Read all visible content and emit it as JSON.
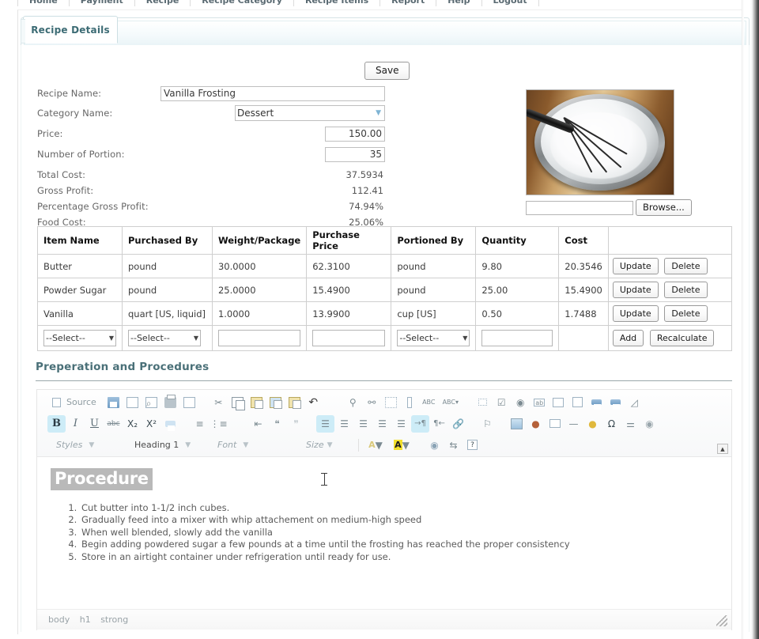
{
  "topnav": {
    "items": [
      "Home",
      "Payment",
      "Recipe",
      "Recipe Category",
      "Recipe Items",
      "Report",
      "Help",
      "Logout"
    ]
  },
  "tab": {
    "label": "Recipe Details"
  },
  "toolbar": {
    "save_label": "Save"
  },
  "form": {
    "recipe_name": {
      "label": "Recipe Name:",
      "value": "Vanilla Frosting"
    },
    "category_name": {
      "label": "Category Name:",
      "value": "Dessert"
    },
    "price": {
      "label": "Price:",
      "value": "150.00"
    },
    "portions": {
      "label": "Number of Portion:",
      "value": "35"
    },
    "total_cost": {
      "label": "Total Cost:",
      "value": "37.5934"
    },
    "gross_profit": {
      "label": "Gross Profit:",
      "value": "112.41"
    },
    "pct_gross_profit": {
      "label": "Percentage Gross Profit:",
      "value": "74.94%"
    },
    "food_cost": {
      "label": "Food Cost:",
      "value": "25.06%"
    }
  },
  "image": {
    "alt": "whisk-in-bowl-of-white-frosting",
    "file_value": "",
    "browse_label": "Browse..."
  },
  "items_table": {
    "columns": [
      "Item Name",
      "Purchased By",
      "Weight/Package",
      "Purchase Price",
      "Portioned By",
      "Quantity",
      "Cost",
      ""
    ],
    "rows": [
      {
        "item_name": "Butter",
        "purchased_by": "pound",
        "weight_package": "30.0000",
        "purchase_price": "62.3100",
        "portioned_by": "pound",
        "quantity": "9.80",
        "cost": "20.3546",
        "update_label": "Update",
        "delete_label": "Delete"
      },
      {
        "item_name": "Powder Sugar",
        "purchased_by": "pound",
        "weight_package": "25.0000",
        "purchase_price": "15.4900",
        "portioned_by": "pound",
        "quantity": "25.00",
        "cost": "15.4900",
        "update_label": "Update",
        "delete_label": "Delete"
      },
      {
        "item_name": "Vanilla",
        "purchased_by": "quart [US, liquid]",
        "weight_package": "1.0000",
        "purchase_price": "13.9900",
        "portioned_by": "cup [US]",
        "quantity": "0.50",
        "cost": "1.7488",
        "update_label": "Update",
        "delete_label": "Delete"
      }
    ],
    "new_row": {
      "item_select": "--Select--",
      "purchased_by_select": "--Select--",
      "weight_package": "",
      "purchase_price": "",
      "portioned_by_select": "--Select--",
      "quantity": "",
      "cost": "",
      "add_label": "Add",
      "recalculate_label": "Recalculate"
    }
  },
  "section": {
    "title": "Preperation and Procedures"
  },
  "editor": {
    "toolbar_row1": [
      {
        "name": "source-icon",
        "label": "Source"
      },
      {
        "name": "new-page-icon"
      },
      {
        "name": "save-icon"
      },
      {
        "name": "preview-icon"
      },
      {
        "name": "print-icon"
      },
      {
        "name": "templates-icon"
      },
      {
        "name": "cut-icon"
      },
      {
        "name": "copy-icon"
      },
      {
        "name": "paste-icon"
      },
      {
        "name": "paste-plain-text-icon"
      },
      {
        "name": "paste-from-word-icon"
      },
      {
        "name": "undo-icon"
      },
      {
        "name": "find-icon"
      },
      {
        "name": "replace-icon"
      },
      {
        "name": "select-all-icon"
      },
      {
        "name": "remove-format-icon"
      },
      {
        "name": "spell-check-icon"
      },
      {
        "name": "spell-check-as-you-type-icon"
      },
      {
        "name": "form-icon"
      },
      {
        "name": "checkbox-icon"
      },
      {
        "name": "radio-button-icon"
      },
      {
        "name": "text-field-icon"
      },
      {
        "name": "textarea-icon"
      },
      {
        "name": "selection-field-icon"
      },
      {
        "name": "button-icon"
      },
      {
        "name": "image-button-icon"
      },
      {
        "name": "hidden-field-icon"
      }
    ],
    "toolbar_row2": [
      {
        "name": "bold-icon",
        "label": "B",
        "active": true
      },
      {
        "name": "italic-icon",
        "label": "I"
      },
      {
        "name": "underline-icon",
        "label": "U"
      },
      {
        "name": "strikethrough-icon",
        "label": "abc"
      },
      {
        "name": "subscript-icon",
        "label": "X₂"
      },
      {
        "name": "superscript-icon",
        "label": "X²"
      },
      {
        "name": "remove-format-icon"
      },
      {
        "name": "numbered-list-icon"
      },
      {
        "name": "bulleted-list-icon"
      },
      {
        "name": "decrease-indent-icon"
      },
      {
        "name": "increase-indent-icon"
      },
      {
        "name": "blockquote-icon"
      },
      {
        "name": "create-div-icon"
      },
      {
        "name": "align-left-icon",
        "active": true
      },
      {
        "name": "align-center-icon"
      },
      {
        "name": "align-right-icon"
      },
      {
        "name": "justify-icon"
      },
      {
        "name": "text-direction-ltr-icon",
        "active": true
      },
      {
        "name": "text-direction-rtl-icon"
      },
      {
        "name": "link-icon"
      },
      {
        "name": "anchor-icon"
      },
      {
        "name": "image-icon"
      },
      {
        "name": "flash-icon"
      },
      {
        "name": "table-icon"
      },
      {
        "name": "horizontal-rule-icon"
      },
      {
        "name": "smiley-icon"
      },
      {
        "name": "special-character-icon"
      },
      {
        "name": "page-break-icon"
      },
      {
        "name": "iframe-icon"
      }
    ],
    "toolbar_row3": {
      "styles_label": "Styles",
      "format_label": "Heading 1",
      "font_label": "Font",
      "size_label": "Size",
      "text_color_label": "A",
      "bg_color_label": "A",
      "maximize_name": "maximize-icon",
      "show_blocks_name": "show-blocks-icon",
      "about_label": "?"
    },
    "collapse_label": "▲",
    "content": {
      "heading": "Procedure",
      "steps": [
        "Cut butter into 1-1/2 inch cubes.",
        "Gradually feed into a mixer with whip attachement on medium-high speed",
        "When well blended, slowly add the vanilla",
        "Begin adding powdered sugar a few pounds at a time until the frosting has reached the proper consistency",
        "Store in an airtight container under refrigeration until ready for use."
      ]
    },
    "elements_path": [
      "body",
      "h1",
      "strong"
    ]
  },
  "colors": {
    "accent": "#4a7078",
    "tab_text": "#3c6b74",
    "toolbar_active": "#cdecf7",
    "heading_highlight": "#b9b9b9"
  }
}
